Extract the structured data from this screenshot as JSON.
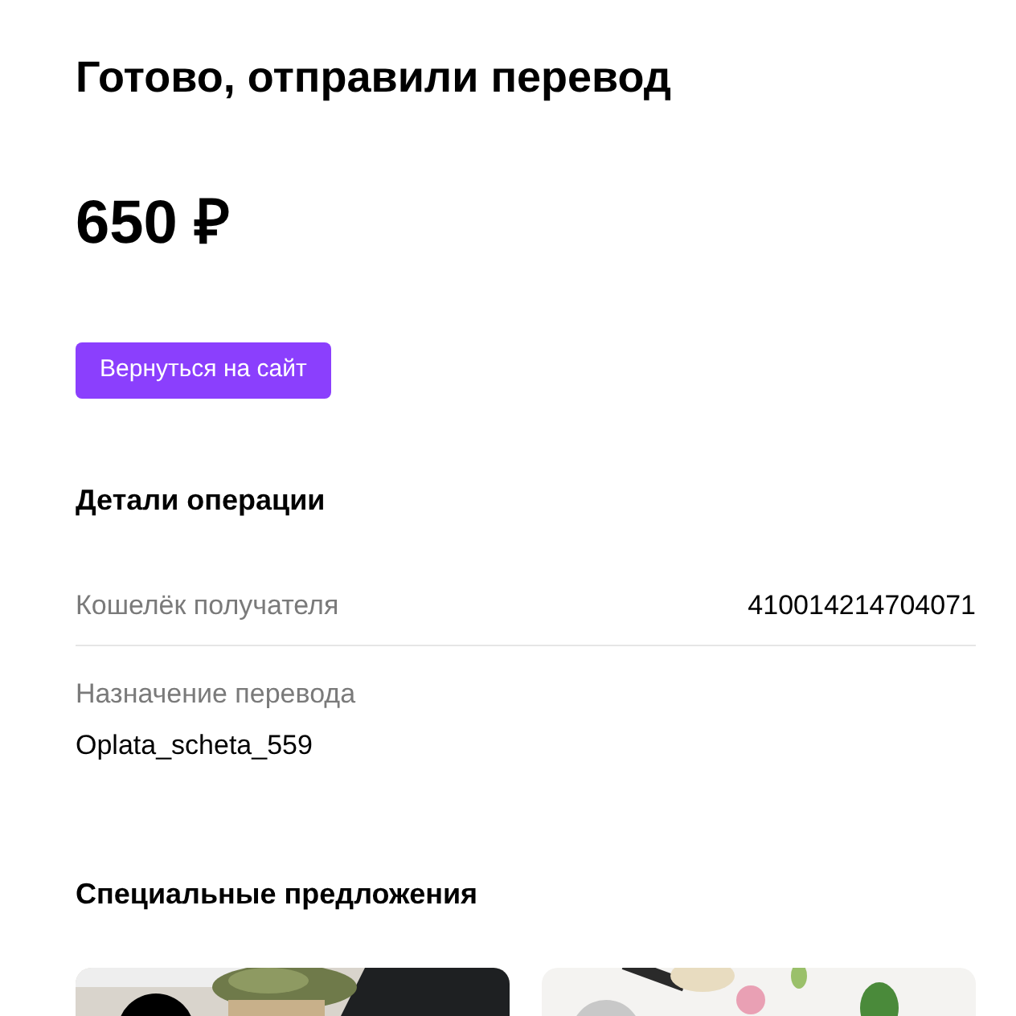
{
  "title": "Готово, отправили перевод",
  "amount": "650 ₽",
  "button": "Вернуться на сайт",
  "details": {
    "heading": "Детали операции",
    "rows": [
      {
        "kind": "inline",
        "label": "Кошелёк получателя",
        "value": "410014214704071"
      },
      {
        "kind": "stacked",
        "label": "Назначение перевода",
        "value": "Oplata_scheta_559"
      }
    ]
  },
  "offers": {
    "heading": "Специальные предложения"
  }
}
